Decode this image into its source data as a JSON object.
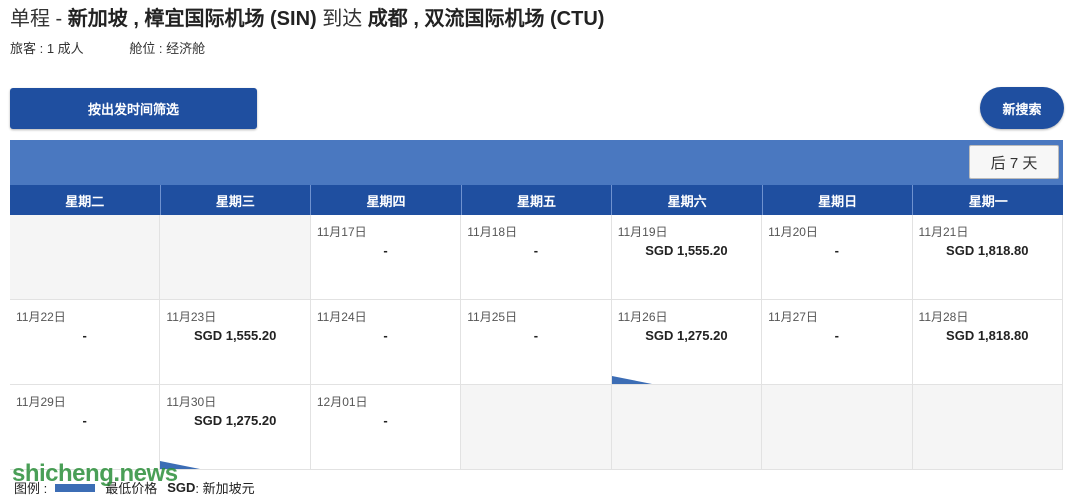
{
  "header": {
    "title_prefix": "单程 - ",
    "origin": "新加坡 , 樟宜国际机场 (SIN)",
    "title_mid": " 到达 ",
    "destination": "成都 , 双流国际机场 (CTU)",
    "passengers": "旅客 : 1 成人",
    "cabin": "舱位 : 经济舱"
  },
  "actions": {
    "filter_label": "按出发时间筛选",
    "new_search_label": "新搜索",
    "next7_label": "后 7 天"
  },
  "calendar": {
    "weekdays": [
      "星期二",
      "星期三",
      "星期四",
      "星期五",
      "星期六",
      "星期日",
      "星期一"
    ],
    "rows": [
      [
        {
          "date": "",
          "price": "",
          "empty": true
        },
        {
          "date": "",
          "price": "",
          "empty": true
        },
        {
          "date": "11月17日",
          "price": "-"
        },
        {
          "date": "11月18日",
          "price": "-"
        },
        {
          "date": "11月19日",
          "price": "SGD 1,555.20"
        },
        {
          "date": "11月20日",
          "price": "-"
        },
        {
          "date": "11月21日",
          "price": "SGD 1,818.80"
        }
      ],
      [
        {
          "date": "11月22日",
          "price": "-"
        },
        {
          "date": "11月23日",
          "price": "SGD 1,555.20"
        },
        {
          "date": "11月24日",
          "price": "-"
        },
        {
          "date": "11月25日",
          "price": "-"
        },
        {
          "date": "11月26日",
          "price": "SGD 1,275.20",
          "lowest": true
        },
        {
          "date": "11月27日",
          "price": "-"
        },
        {
          "date": "11月28日",
          "price": "SGD 1,818.80"
        }
      ],
      [
        {
          "date": "11月29日",
          "price": "-"
        },
        {
          "date": "11月30日",
          "price": "SGD 1,275.20",
          "lowest": true
        },
        {
          "date": "12月01日",
          "price": "-"
        },
        {
          "date": "",
          "price": "",
          "empty": true
        },
        {
          "date": "",
          "price": "",
          "empty": true
        },
        {
          "date": "",
          "price": "",
          "empty": true
        },
        {
          "date": "",
          "price": "",
          "empty": true
        }
      ]
    ]
  },
  "legend": {
    "label": "图例 :",
    "lowest_label": "最低价格",
    "sgd_key": "SGD",
    "sgd_desc": ": 新加坡元"
  },
  "watermark": "shicheng.news",
  "colors": {
    "primary": "#1f4fa0",
    "bar": "#4a78c0",
    "lowest_marker": "#3c6db5",
    "watermark": "#2b8f3a"
  }
}
